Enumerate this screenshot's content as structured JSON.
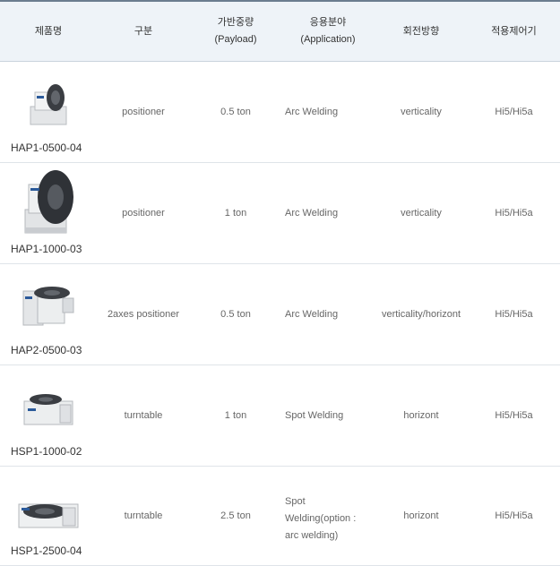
{
  "headers": {
    "name": "제품명",
    "type": "구분",
    "payload_ko": "가반중량",
    "payload_en": "(Payload)",
    "application_ko": "응용분야",
    "application_en": "(Application)",
    "rotation": "회전방향",
    "controller": "적용제어기"
  },
  "rows": [
    {
      "name": "HAP1-0500-04",
      "type": "positioner",
      "payload": "0.5 ton",
      "application": "Arc Welding",
      "rotation": "verticality",
      "controller": "Hi5/Hi5a",
      "image_icon": "positioner-small-icon"
    },
    {
      "name": "HAP1-1000-03",
      "type": "positioner",
      "payload": "1 ton",
      "application": "Arc Welding",
      "rotation": "verticality",
      "controller": "Hi5/Hi5a",
      "image_icon": "positioner-large-icon"
    },
    {
      "name": "HAP2-0500-03",
      "type": "2axes positioner",
      "payload": "0.5 ton",
      "application": "Arc Welding",
      "rotation": "verticality/horizont",
      "controller": "Hi5/Hi5a",
      "image_icon": "two-axes-positioner-icon"
    },
    {
      "name": "HSP1-1000-02",
      "type": "turntable",
      "payload": "1 ton",
      "application": "Spot Welding",
      "rotation": "horizont",
      "controller": "Hi5/Hi5a",
      "image_icon": "turntable-small-icon"
    },
    {
      "name": "HSP1-2500-04",
      "type": "turntable",
      "payload": "2.5 ton",
      "application_lines": [
        "Spot",
        "Welding(option :",
        "arc welding)"
      ],
      "rotation": "horizont",
      "controller": "Hi5/Hi5a",
      "image_icon": "turntable-large-icon"
    }
  ]
}
